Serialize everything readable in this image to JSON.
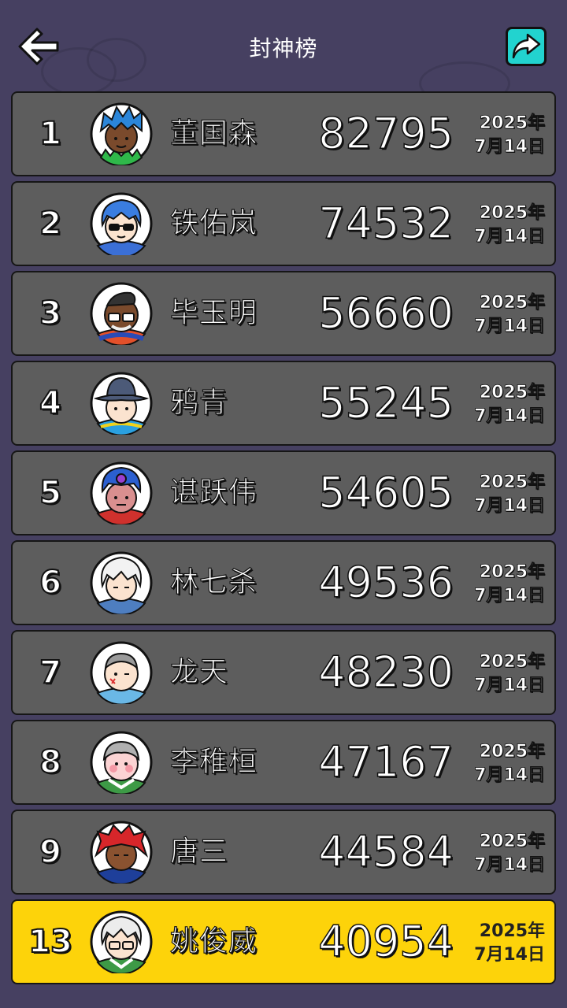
{
  "header": {
    "title": "封神榜",
    "back_icon": "arrow-left-icon",
    "share_icon": "share-arrow-icon",
    "share_color": "#22d3cf"
  },
  "theme": {
    "background": "#464061",
    "row_bg": "#5d5d5d",
    "highlight_bg": "#fdd30a"
  },
  "leaderboard": [
    {
      "rank": "1",
      "name": "董国森",
      "score": "82795",
      "date_year": "2025年",
      "date_day": "7月14日"
    },
    {
      "rank": "2",
      "name": "铁佑岚",
      "score": "74532",
      "date_year": "2025年",
      "date_day": "7月14日"
    },
    {
      "rank": "3",
      "name": "毕玉明",
      "score": "56660",
      "date_year": "2025年",
      "date_day": "7月14日"
    },
    {
      "rank": "4",
      "name": "鸦青",
      "score": "55245",
      "date_year": "2025年",
      "date_day": "7月14日"
    },
    {
      "rank": "5",
      "name": "谌跃伟",
      "score": "54605",
      "date_year": "2025年",
      "date_day": "7月14日"
    },
    {
      "rank": "6",
      "name": "林七杀",
      "score": "49536",
      "date_year": "2025年",
      "date_day": "7月14日"
    },
    {
      "rank": "7",
      "name": "龙天",
      "score": "48230",
      "date_year": "2025年",
      "date_day": "7月14日"
    },
    {
      "rank": "8",
      "name": "李稚桓",
      "score": "47167",
      "date_year": "2025年",
      "date_day": "7月14日"
    },
    {
      "rank": "9",
      "name": "唐三",
      "score": "44584",
      "date_year": "2025年",
      "date_day": "7月14日"
    }
  ],
  "current_player": {
    "rank": "13",
    "name": "姚俊威",
    "score": "40954",
    "date_year": "2025年",
    "date_day": "7月14日"
  }
}
